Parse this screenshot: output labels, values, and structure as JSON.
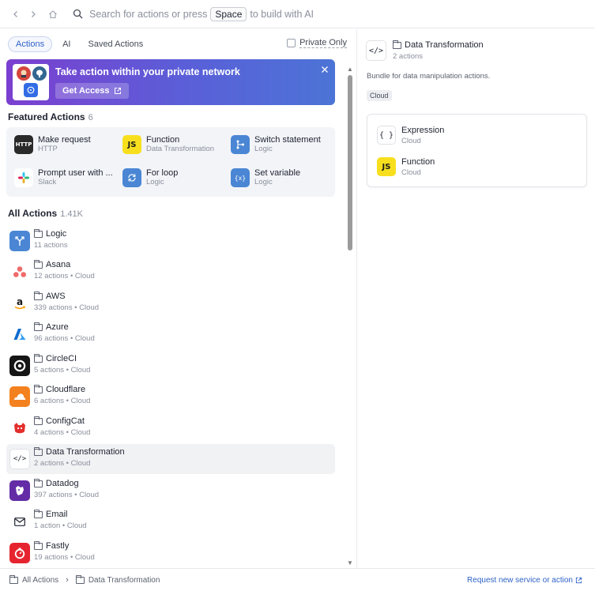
{
  "search": {
    "text_before": "Search for actions or press",
    "key": "Space",
    "text_after": "to build with AI"
  },
  "tabs": [
    {
      "label": "Actions",
      "active": true
    },
    {
      "label": "AI",
      "active": false
    },
    {
      "label": "Saved Actions",
      "active": false
    }
  ],
  "private_only": {
    "label": "Private Only",
    "checked": false
  },
  "banner": {
    "title": "Take action within your private network",
    "button_label": "Get Access"
  },
  "featured": {
    "title": "Featured Actions",
    "count": "6",
    "items": [
      {
        "name": "Make request",
        "sub": "HTTP",
        "icon": "http-icon"
      },
      {
        "name": "Function",
        "sub": "Data Transformation",
        "icon": "js-icon"
      },
      {
        "name": "Switch statement",
        "sub": "Logic",
        "icon": "switch-icon"
      },
      {
        "name": "Prompt user with ...",
        "sub": "Slack",
        "icon": "slack-icon"
      },
      {
        "name": "For loop",
        "sub": "Logic",
        "icon": "loop-icon"
      },
      {
        "name": "Set variable",
        "sub": "Logic",
        "icon": "variable-icon"
      }
    ]
  },
  "all_actions": {
    "title": "All Actions",
    "count": "1.41K",
    "items": [
      {
        "name": "Logic",
        "sub": "11 actions"
      },
      {
        "name": "Asana",
        "sub": "12 actions • Cloud"
      },
      {
        "name": "AWS",
        "sub": "339 actions • Cloud"
      },
      {
        "name": "Azure",
        "sub": "96 actions • Cloud"
      },
      {
        "name": "CircleCI",
        "sub": "5 actions • Cloud"
      },
      {
        "name": "Cloudflare",
        "sub": "6 actions • Cloud"
      },
      {
        "name": "ConfigCat",
        "sub": "4 actions • Cloud"
      },
      {
        "name": "Data Transformation",
        "sub": "2 actions • Cloud",
        "selected": true
      },
      {
        "name": "Datadog",
        "sub": "397 actions • Cloud"
      },
      {
        "name": "Email",
        "sub": "1 action • Cloud"
      },
      {
        "name": "Fastly",
        "sub": "19 actions • Cloud"
      }
    ]
  },
  "detail": {
    "icon_glyph": "</>",
    "title": "Data Transformation",
    "sub": "2 actions",
    "description": "Bundle for data manipulation actions.",
    "badge": "Cloud",
    "actions": [
      {
        "name": "Expression",
        "sub": "Cloud",
        "icon_glyph": "{ }"
      },
      {
        "name": "Function",
        "sub": "Cloud",
        "icon_glyph": "JS"
      }
    ]
  },
  "footer": {
    "crumb_root": "All Actions",
    "crumb_current": "Data Transformation",
    "request_link": "Request new service or action"
  },
  "colors": {
    "accent": "#2f63c7",
    "banner_start": "#7b3fd0",
    "banner_end": "#4c74d6",
    "js_yellow": "#f7df1e"
  }
}
